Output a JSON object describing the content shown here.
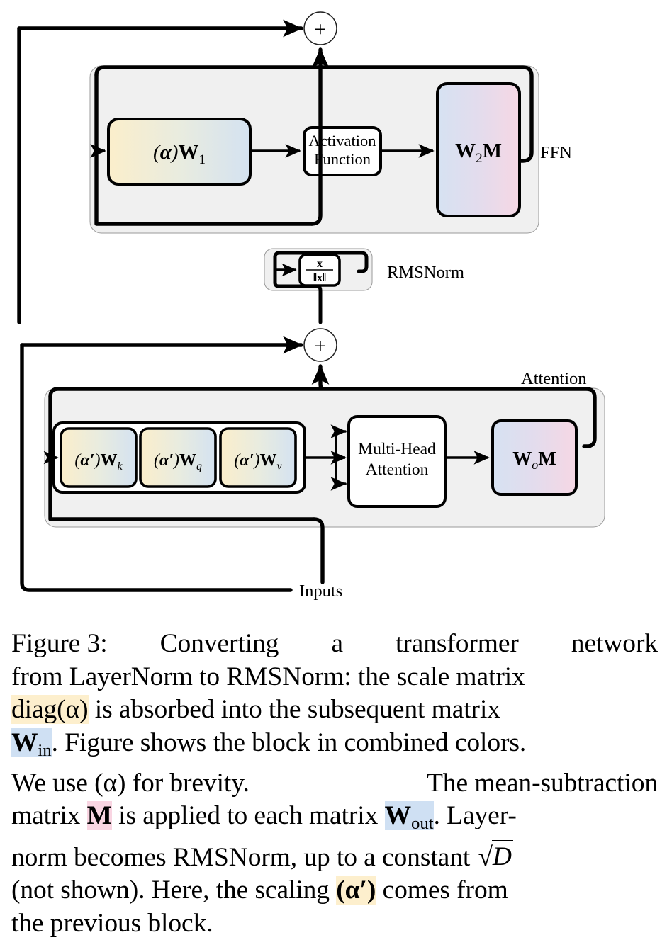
{
  "figure": {
    "label": "Figure 3:",
    "nodes": {
      "add_top": "+",
      "add_bottom": "+",
      "ffn_w1": "(α)W",
      "ffn_w1_sub": "1",
      "activation_line1": "Activation",
      "activation_line2": "Function",
      "ffn_w2": "W",
      "ffn_w2_sub": "2",
      "ffn_w2_tail": "M",
      "rmsnorm_numerator": "x",
      "rmsnorm_denominator": "‖x‖",
      "attn_wk": "(α′)W",
      "attn_wk_sub": "k",
      "attn_wq": "(α′)W",
      "attn_wq_sub": "q",
      "attn_wv": "(α′)W",
      "attn_wv_sub": "v",
      "mha_line1": "Multi-Head",
      "mha_line2": "Attention",
      "attn_wo": "W",
      "attn_wo_sub": "o",
      "attn_wo_tail": "M"
    },
    "labels": {
      "ffn": "FFN",
      "rmsnorm": "RMSNorm",
      "attention": "Attention",
      "inputs": "Inputs"
    },
    "colors": {
      "group_fill": "#f0f0f0",
      "stroke": "#000000",
      "alpha_gradient_start": "#fbeecb",
      "alpha_gradient_end": "#d4e2f1",
      "m_gradient_start": "#d6e2f2",
      "m_gradient_end": "#f6d7e4",
      "plain_fill": "#ffffff",
      "highlight_yellow": "#fdefcd",
      "highlight_blue": "#cfe0f3",
      "highlight_pink": "#f9d5e2"
    }
  },
  "caption": {
    "line1_a": "Figure 3:",
    "line1_b": "Converting",
    "line1_c": "a",
    "line1_d": "transformer",
    "line1_e": "network",
    "line2": "from LayerNorm to RMSNorm: the scale matrix",
    "line3_hl": "diag(α)",
    "line3_rest": " is absorbed into the subsequent matrix",
    "line4_hl_w": "W",
    "line4_hl_sub": "in",
    "line4_rest": ". Figure shows the block in combined colors.",
    "line5_a": "We use (α) for brevity.",
    "line5_b": "The mean-subtraction",
    "line6_a": "matrix ",
    "line6_hl_m": "M",
    "line6_b": " is applied to each matrix ",
    "line6_hl_w": "W",
    "line6_hl_sub": "out",
    "line6_c": ". Layer-",
    "line7_a": "norm becomes RMSNorm, up to a constant ",
    "line7_sqrt": "D",
    "line8_a": "(not shown). Here, the scaling ",
    "line8_hl": "(α′)",
    "line8_b": " comes from",
    "line9": "the previous block."
  }
}
